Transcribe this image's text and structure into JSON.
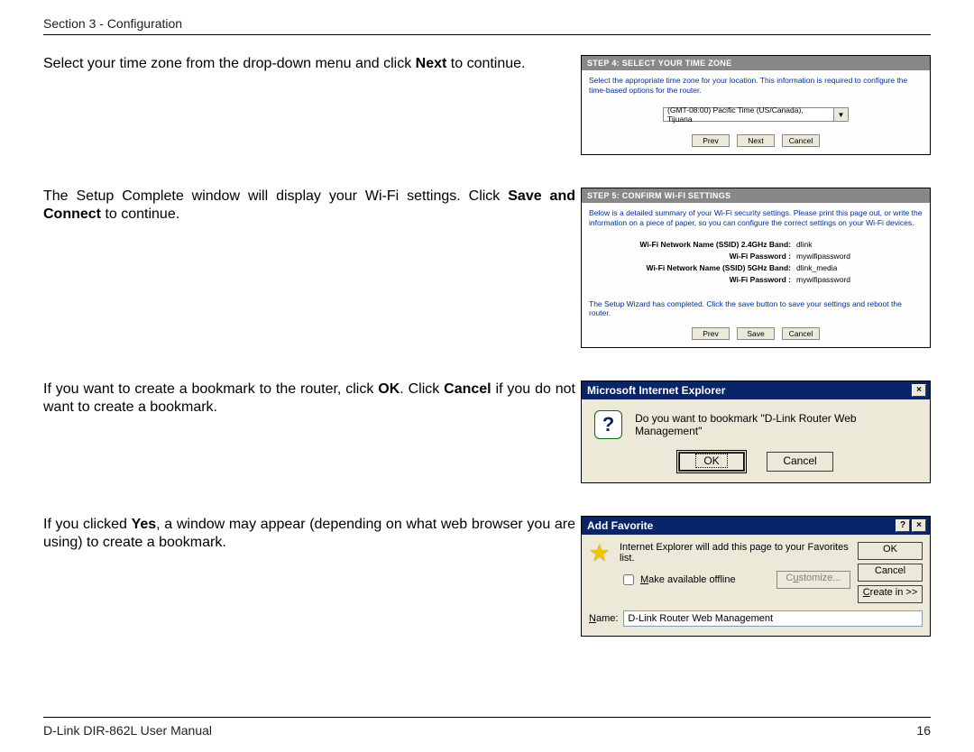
{
  "header": {
    "section": "Section 3 - Configuration"
  },
  "footer": {
    "manual": "D-Link DIR-862L User Manual",
    "page": "16"
  },
  "instr1": {
    "pre": "Select your time zone from the drop-down menu and click ",
    "b1": "Next",
    "post": " to continue."
  },
  "instr2": {
    "pre": "The Setup Complete window will display your Wi-Fi settings. Click ",
    "b1": "Save and Connect",
    "post": " to continue."
  },
  "instr3": {
    "pre": "If you want to create a bookmark to the router, click ",
    "b1": "OK",
    "mid": ". Click ",
    "b2": "Cancel",
    "post": " if you do not want to create a bookmark."
  },
  "instr4": {
    "pre": "If you clicked ",
    "b1": "Yes",
    "post": ", a window may appear (depending on what web browser you are using) to create a bookmark."
  },
  "wiz1": {
    "title": "STEP 4: SELECT YOUR TIME ZONE",
    "desc": "Select the appropriate time zone for your location. This information is required to configure the time-based options for the router.",
    "tz": "(GMT-08:00) Pacific Time (US/Canada), Tijuana",
    "buttons": {
      "prev": "Prev",
      "next": "Next",
      "cancel": "Cancel"
    }
  },
  "wiz2": {
    "title": "STEP 5: CONFIRM WI-FI SETTINGS",
    "desc": "Below is a detailed summary of your Wi-Fi security settings. Please print this page out, or write the information on a piece of paper, so you can configure the correct settings on your Wi-Fi devices.",
    "rows": [
      {
        "label": "Wi-Fi Network Name (SSID) 2.4GHz Band:",
        "value": "dlink"
      },
      {
        "label": "Wi-Fi Password :",
        "value": "mywifipassword"
      },
      {
        "label": "Wi-Fi Network Name (SSID) 5GHz Band:",
        "value": "dlink_media"
      },
      {
        "label": "Wi-Fi Password :",
        "value": "mywifipassword"
      }
    ],
    "done": "The Setup Wizard has completed. Click the save button to save your settings and reboot the router.",
    "buttons": {
      "prev": "Prev",
      "save": "Save",
      "cancel": "Cancel"
    }
  },
  "ie": {
    "title": "Microsoft Internet Explorer",
    "msg": "Do you want to bookmark \"D-Link Router Web Management\"",
    "ok": "OK",
    "cancel": "Cancel",
    "close": "×"
  },
  "fav": {
    "title": "Add Favorite",
    "help": "?",
    "close": "×",
    "msg": "Internet Explorer will add this page to your Favorites list.",
    "make_offline_u": "M",
    "make_offline": "ake available offline",
    "customize_u": "u",
    "customize_pre": "C",
    "customize_post": "stomize...",
    "ok": "OK",
    "cancel": "Cancel",
    "create_u": "C",
    "create_post": "reate in >>",
    "name_u": "N",
    "name_post": "ame:",
    "name_val": "D-Link Router Web Management"
  }
}
